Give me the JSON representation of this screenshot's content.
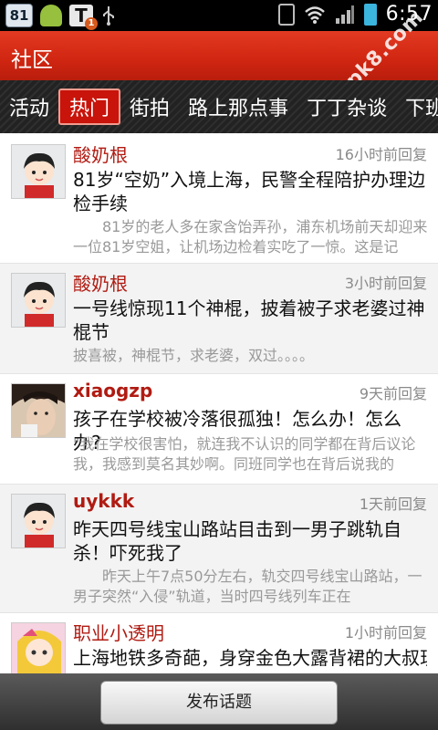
{
  "status_bar": {
    "badge": "81",
    "t_icon": "T",
    "t_icon_count": "1",
    "time": "6:57",
    "icons": [
      "android-icon",
      "usb-icon",
      "vibrate-icon",
      "wifi-icon",
      "signal-icon",
      "battery-icon"
    ]
  },
  "header": {
    "title": "社区",
    "watermark": "apk8.com"
  },
  "tabs": [
    {
      "label": "活动",
      "active": false
    },
    {
      "label": "热门",
      "active": true
    },
    {
      "label": "街拍",
      "active": false
    },
    {
      "label": "路上那点事",
      "active": false
    },
    {
      "label": "丁丁杂谈",
      "active": false
    },
    {
      "label": "下班",
      "active": false
    }
  ],
  "posts": [
    {
      "author": "酸奶根",
      "time": "16小时前回复",
      "topic": "81岁“空奶”入境上海，民警全程陪护办理边检手续",
      "excerpt": "　　81岁的老人多在家含饴弄孙，浦东机场前天却迎来一位81岁空姐，让机场边检着实吃了一惊。这是记",
      "avatar": "cartoon-boy"
    },
    {
      "author": "酸奶根",
      "time": "3小时前回复",
      "topic": "一号线惊现11个神棍，披着被子求老婆过神棍节",
      "excerpt": "披喜被，神棍节，求老婆，双过。。。。",
      "avatar": "cartoon-boy"
    },
    {
      "author": "xiaogzp",
      "time": "9天前回复",
      "topic": "孩子在学校被冷落很孤独！怎么办！怎么办?",
      "excerpt": "\"我在学校很害怕，就连我不认识的同学都在背后议论我，我感到莫名其妙啊。同班同学也在背后说我的",
      "avatar": "photo"
    },
    {
      "author": "uykkk",
      "time": "1天前回复",
      "topic": "昨天四号线宝山路站目击到一男子跳轨自杀！吓死我了",
      "excerpt": "　　昨天上午7点50分左右，轨交四号线宝山路站，一男子突然“入侵”轨道，当时四号线列车正在",
      "avatar": "cartoon-boy"
    },
    {
      "author": "职业小透明",
      "time": "1小时前回复",
      "topic": "上海地铁多奇葩，身穿金色大露背裙的大叔现",
      "excerpt": "",
      "avatar": "cartoon-girl"
    }
  ],
  "bottom": {
    "publish_label": "发布话题"
  }
}
